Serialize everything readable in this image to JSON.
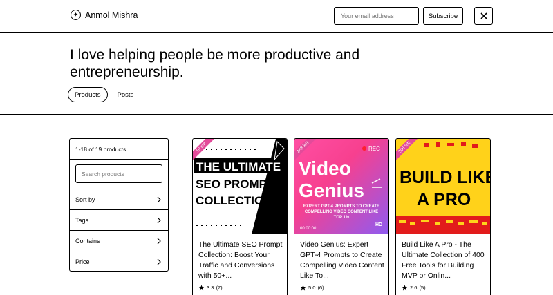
{
  "header": {
    "name": "Anmol Mishra",
    "email_placeholder": "Your email address",
    "subscribe_label": "Subscribe",
    "x_label": "X"
  },
  "hero": {
    "tagline": "I love helping people be more productive and entrepreneurship.",
    "tabs": [
      {
        "label": "Products",
        "active": true
      },
      {
        "label": "Posts",
        "active": false
      }
    ]
  },
  "filters": {
    "count": "1-18 of 19 products",
    "search_placeholder": "Search products",
    "items": [
      {
        "label": "Sort by"
      },
      {
        "label": "Tags"
      },
      {
        "label": "Contains"
      },
      {
        "label": "Price"
      }
    ]
  },
  "products": [
    {
      "title": "The Ultimate SEO Prompt Collection: Boost Your Traffic and Conversions with 50+...",
      "rating": "3.3",
      "reviews": "(7)",
      "badge": "10 left",
      "thumb_lines": [
        "THE ULTIMATE",
        "SEO PROMPT",
        "COLLECTION"
      ]
    },
    {
      "title": "Video Genius: Expert GPT-4 Prompts to Create Compelling Video Content Like To...",
      "rating": "5.0",
      "reviews": "(6)",
      "badge": "263 left",
      "thumb_lines": [
        "Video",
        "Genius",
        "EXPERT GPT-4 PROMPTS TO CREATE COMPELLING VIDEO CONTENT LIKE TOP 1%",
        "00:00:00",
        "HD",
        "REC"
      ]
    },
    {
      "title": "Build Like A Pro - The Ultimate Collection of 400 Free Tools for Building MVP or Onlin...",
      "rating": "2.6",
      "reviews": "(5)",
      "badge": "296 left",
      "thumb_lines": [
        "BUILD LIKE",
        "A PRO"
      ]
    }
  ],
  "colors": {
    "border": "#000000",
    "badge_pink": "#e34b9a",
    "genius_gradient_start": "#f7408f",
    "genius_gradient_end": "#8f5bf0",
    "build_yellow": "#ffd21a",
    "build_red": "#e21b1b"
  }
}
